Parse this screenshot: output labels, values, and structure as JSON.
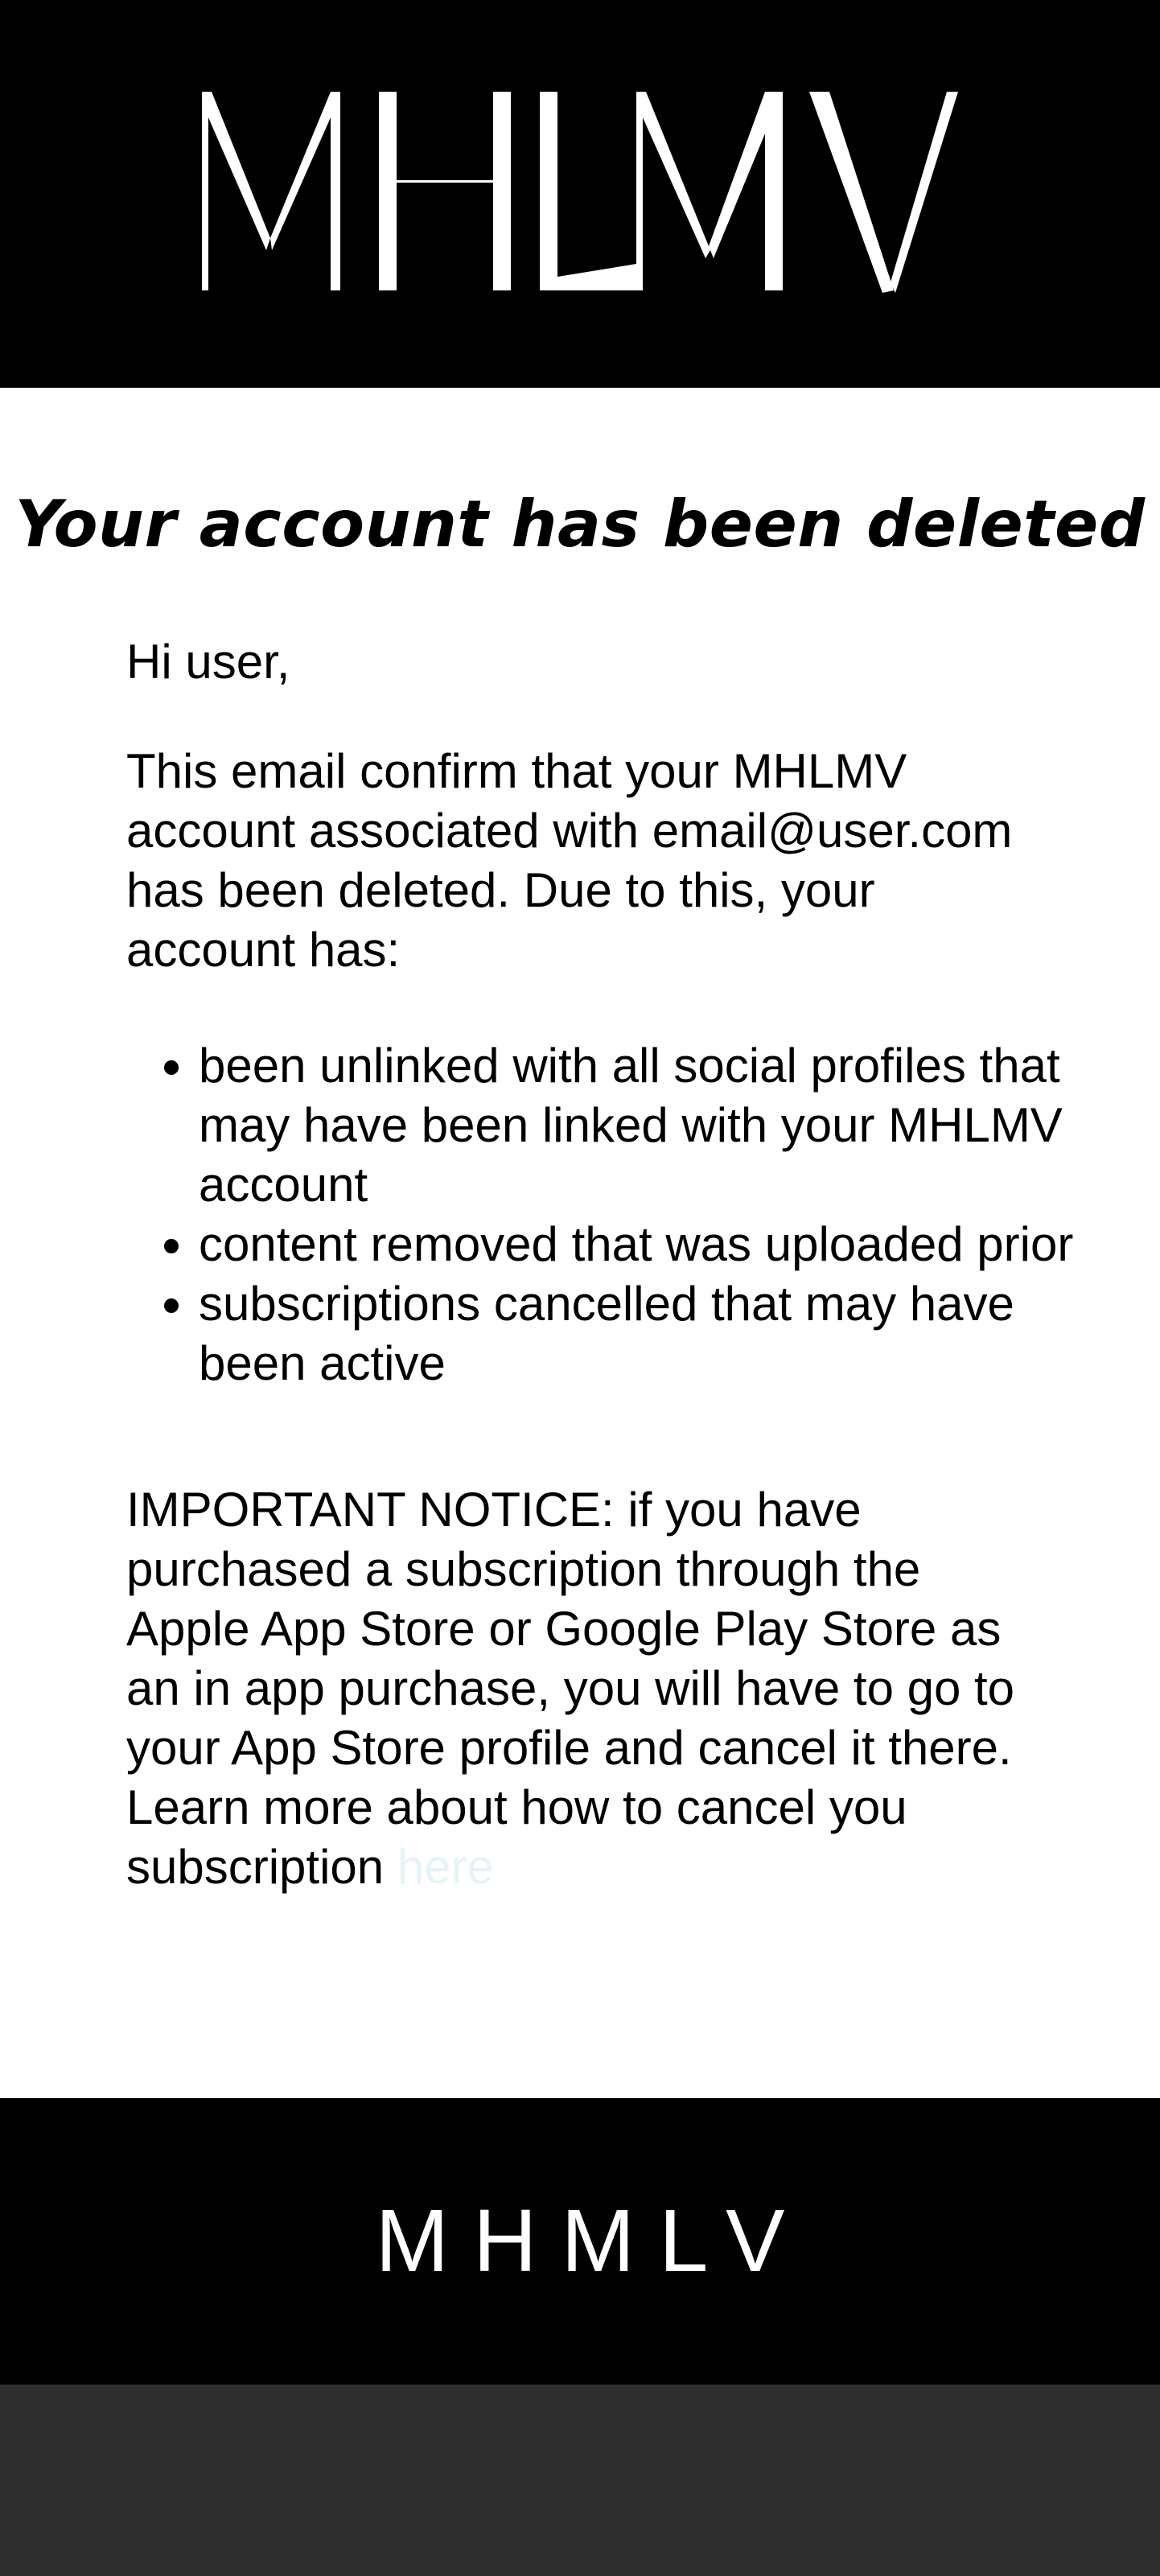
{
  "header": {
    "logo_text": "MHLMV",
    "background_color": "#000000"
  },
  "main": {
    "headline": "Your account has been deleted",
    "greeting": "Hi user,",
    "intro": "This email confirm that your MHLMV account associated with email@user.com has been deleted. Due to this, your account has:",
    "bullets": [
      "been unlinked with all social profiles that may have been linked with your MHLMV account",
      "content removed that was uploaded prior",
      "subscriptions cancelled that may have been active"
    ],
    "notice_text": "IMPORTANT NOTICE: if you have purchased a subscription through the Apple App Store or Google Play Store as an in app purchase, you will have to go to your App Store profile and cancel it there. Learn more about how to cancel you subscription ",
    "notice_link_label": "here",
    "link_color": "#e7f4f6"
  },
  "footer": {
    "brand": "MHMLV",
    "background_color": "#000000"
  },
  "bottom_bar_color": "#2e2e2e"
}
